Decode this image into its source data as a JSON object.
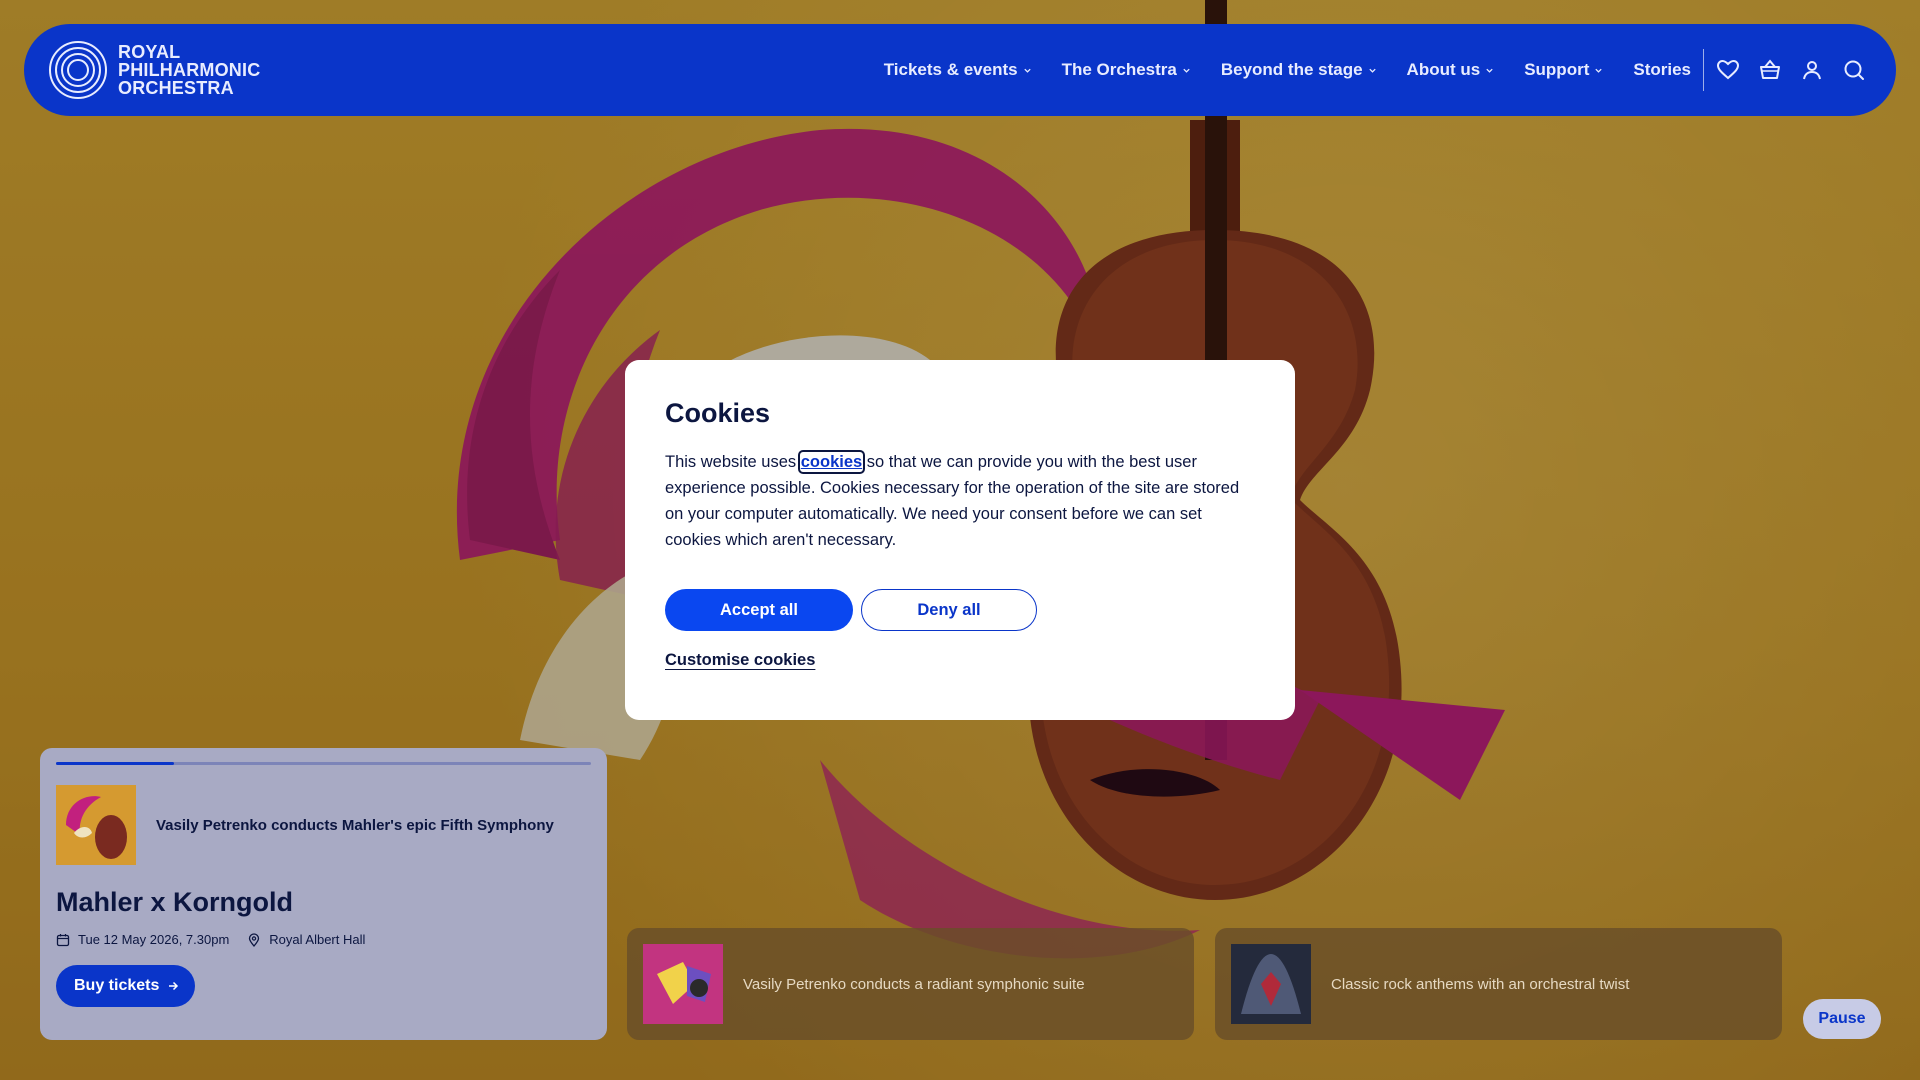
{
  "header": {
    "logo_lines": [
      "ROYAL",
      "PHILHARMONIC",
      "ORCHESTRA"
    ],
    "nav": [
      {
        "label": "Tickets & events",
        "dropdown": true
      },
      {
        "label": "The Orchestra",
        "dropdown": true
      },
      {
        "label": "Beyond the stage",
        "dropdown": true
      },
      {
        "label": "About us",
        "dropdown": true
      },
      {
        "label": "Support",
        "dropdown": true
      },
      {
        "label": "Stories",
        "dropdown": false
      }
    ],
    "icons": [
      "heart-icon",
      "basket-icon",
      "user-icon",
      "search-icon"
    ]
  },
  "featured": {
    "progress": 0.22,
    "subtitle": "Vasily Petrenko conducts Mahler's epic Fifth Symphony",
    "title": "Mahler x Korngold",
    "date": "Tue 12 May 2026, 7.30pm",
    "venue": "Royal Albert Hall",
    "buy_label": "Buy tickets"
  },
  "cards": [
    {
      "subtitle": "Vasily Petrenko conducts a radiant symphonic suite"
    },
    {
      "subtitle": "Classic rock anthems with an orchestral twist"
    }
  ],
  "carousel": {
    "pause_label": "Pause"
  },
  "cookie_modal": {
    "title": "Cookies",
    "text_before": "This website uses ",
    "link_text": "cookies",
    "text_after": " so that we can provide you with the best user experience possible. Cookies necessary for the operation of the site are stored on your computer automatically. We need your consent before we can set cookies which aren't necessary.",
    "accept_label": "Accept all",
    "deny_label": "Deny all",
    "customise_label": "Customise cookies"
  },
  "colors": {
    "brand_blue": "#0a35c9",
    "accent_magenta": "#c2207e",
    "background_gold": "#d8a22c"
  }
}
